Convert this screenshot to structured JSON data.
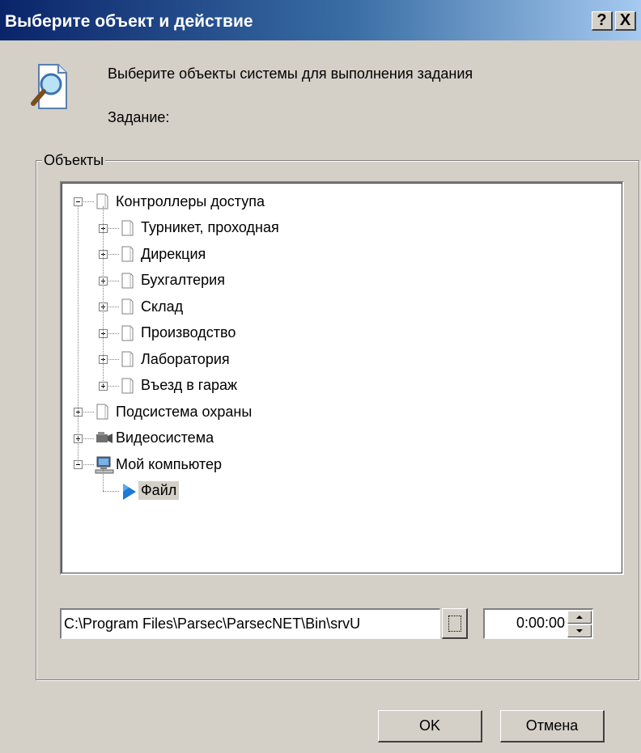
{
  "window": {
    "title": "Выберите объект и действие",
    "help_label": "?",
    "close_label": "X"
  },
  "header": {
    "icon": "search-document-icon",
    "instruction": "Выберите объекты системы для выполнения задания",
    "task_label": "Задание:"
  },
  "objects_group": {
    "label": "Объекты",
    "tree": [
      {
        "label": "Контроллеры доступа",
        "level": 0,
        "state": "expanded",
        "icon": "folder-icon"
      },
      {
        "label": "Турникет, проходная",
        "level": 1,
        "state": "collapsed",
        "icon": "folder-icon"
      },
      {
        "label": "Дирекция",
        "level": 1,
        "state": "collapsed",
        "icon": "folder-icon"
      },
      {
        "label": "Бухгалтерия",
        "level": 1,
        "state": "collapsed",
        "icon": "folder-icon"
      },
      {
        "label": "Склад",
        "level": 1,
        "state": "collapsed",
        "icon": "folder-icon"
      },
      {
        "label": "Производство",
        "level": 1,
        "state": "collapsed",
        "icon": "folder-icon"
      },
      {
        "label": "Лаборатория",
        "level": 1,
        "state": "collapsed",
        "icon": "folder-icon"
      },
      {
        "label": "Въезд в гараж",
        "level": 1,
        "state": "collapsed",
        "icon": "folder-icon"
      },
      {
        "label": "Подсистема охраны",
        "level": 0,
        "state": "collapsed",
        "icon": "folder-icon"
      },
      {
        "label": "Видеосистема",
        "level": 0,
        "state": "collapsed",
        "icon": "camera-icon"
      },
      {
        "label": "Мой компьютер",
        "level": 0,
        "state": "expanded",
        "icon": "computer-icon"
      },
      {
        "label": "Файл",
        "level": 1,
        "state": "leaf",
        "icon": "play-arrow-icon",
        "selected": true
      }
    ]
  },
  "path_input": {
    "value": "C:\\Program Files\\Parsec\\ParsecNET\\Bin\\srvU"
  },
  "time_input": {
    "value": "0:00:00"
  },
  "buttons": {
    "ok": "OK",
    "cancel": "Отмена"
  },
  "colors": {
    "titlebar_start": "#0a246a",
    "titlebar_end": "#a6caf0",
    "face": "#d4d0c8"
  }
}
